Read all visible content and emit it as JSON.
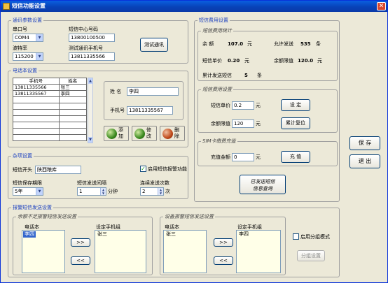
{
  "window": {
    "title": "短信功能设置"
  },
  "comm": {
    "group_title": "通讯参数设置",
    "port_label": "串口号",
    "port_value": "COM4",
    "baud_label": "波特率",
    "baud_value": "115200",
    "center_label": "短信中心号码",
    "center_value": "13800100500",
    "test_phone_label": "测试通讯手机号",
    "test_phone_value": "13811335566",
    "test_button": "测试通讯"
  },
  "phonebook": {
    "group_title": "电话本设置",
    "columns": [
      "手机号",
      "姓名"
    ],
    "rows": [
      [
        "13811335566",
        "张三"
      ],
      [
        "13811335567",
        "李四"
      ]
    ],
    "name_label": "姓 名",
    "name_value": "李四",
    "phone_label": "手机号",
    "phone_value": "13811335567",
    "add_label": "添加",
    "edit_label": "修改",
    "delete_label": "删除"
  },
  "misc": {
    "group_title": "杂项设置",
    "header_label": "短信开头",
    "header_value": "陕西粮库",
    "alarm_checkbox_label": "启用短信报警功能",
    "keep_label": "短信保存期限",
    "keep_value": "5年",
    "interval_label": "短信发送间隔",
    "interval_value": "1",
    "interval_unit": "分钟",
    "repeat_label": "连续发送次数",
    "repeat_value": "2",
    "repeat_unit": "次"
  },
  "fee": {
    "group_title": "短信费用设置",
    "stats_title": "短信费用统计",
    "balance_label": "余    额",
    "balance_value": "107.0",
    "balance_unit": "元",
    "allow_label": "允许发送",
    "allow_value": "535",
    "allow_unit": "条",
    "price_label": "短信单价",
    "price_value": "0.20",
    "price_unit": "元",
    "limit_label": "余额限值",
    "limit_value": "120.0",
    "limit_unit": "元",
    "total_label": "累计发送短信",
    "total_value": "5",
    "total_unit": "条",
    "setting_title": "短信费用设置",
    "set_price_label": "短信单价",
    "set_price_value": "0.2",
    "set_price_unit": "元",
    "set_button": "设 定",
    "set_limit_label": "余额限值",
    "set_limit_value": "120",
    "set_limit_unit": "元",
    "reset_button": "累计复位",
    "sim_title": "SIM卡缴费充值",
    "recharge_label": "充值金额",
    "recharge_value": "0",
    "recharge_unit": "元",
    "recharge_button": "充 值",
    "query_button_line1": "已发送短信",
    "query_button_line2": "信息查询"
  },
  "alarm_group": {
    "group_title": "报警短信发送设置",
    "low_title": "余额不足报警短信发送设置",
    "low_book_label": "电话本",
    "low_book_items": [
      "李四"
    ],
    "low_set_label": "设定手机组",
    "low_set_items": [
      "张三"
    ],
    "dev_title": "设备报警短信发送设置",
    "dev_book_label": "电话本",
    "dev_book_items": [
      "张三"
    ],
    "dev_set_label": "设定手机组",
    "dev_set_items": [
      "李四"
    ],
    "move_right": ">>",
    "move_left": "<<",
    "multi_group_label": "启用分组模式",
    "group_settings_button": "分组设置"
  },
  "side": {
    "save_button": "保 存",
    "exit_button": "退 出"
  }
}
